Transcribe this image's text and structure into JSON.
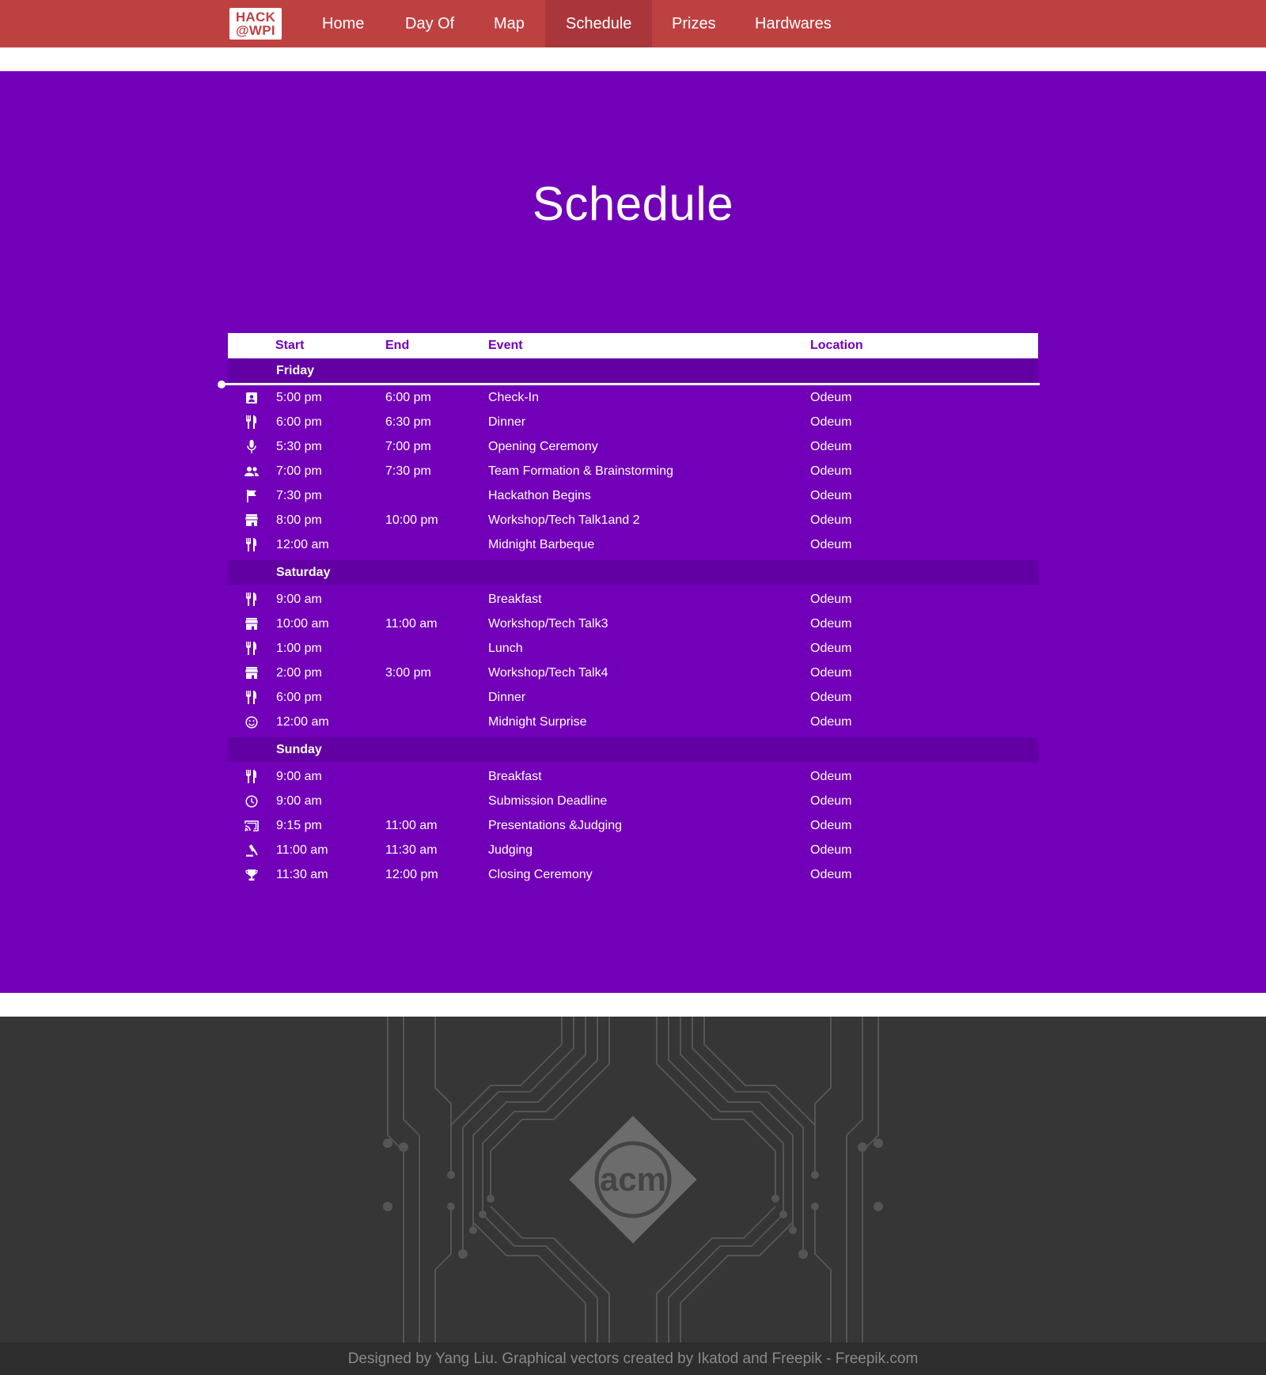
{
  "brand": {
    "logo_line1": "HACK",
    "logo_line2": "@WPI"
  },
  "nav": {
    "items": [
      {
        "label": "Home"
      },
      {
        "label": "Day Of"
      },
      {
        "label": "Map"
      },
      {
        "label": "Schedule"
      },
      {
        "label": "Prizes"
      },
      {
        "label": "Hardwares"
      }
    ],
    "active": "Schedule"
  },
  "page": {
    "title": "Schedule"
  },
  "table": {
    "headers": {
      "start": "Start",
      "end": "End",
      "event": "Event",
      "location": "Location"
    },
    "days": [
      {
        "name": "Friday",
        "events": [
          {
            "icon": "badge-icon",
            "start": "5:00 pm",
            "end": "6:00 pm",
            "event": "Check-In",
            "location": "Odeum"
          },
          {
            "icon": "utensils-icon",
            "start": "6:00 pm",
            "end": "6:30 pm",
            "event": "Dinner",
            "location": "Odeum"
          },
          {
            "icon": "microphone-icon",
            "start": "5:30 pm",
            "end": "7:00 pm",
            "event": "Opening Ceremony",
            "location": "Odeum"
          },
          {
            "icon": "people-icon",
            "start": "7:00 pm",
            "end": "7:30 pm",
            "event": "Team Formation & Brainstorming",
            "location": "Odeum"
          },
          {
            "icon": "flag-icon",
            "start": "7:30 pm",
            "end": "",
            "event": "Hackathon Begins",
            "location": "Odeum"
          },
          {
            "icon": "store-icon",
            "start": "8:00 pm",
            "end": "10:00 pm",
            "event": "Workshop/Tech Talk1and 2",
            "location": "Odeum"
          },
          {
            "icon": "utensils-icon",
            "start": "12:00 am",
            "end": "",
            "event": "Midnight Barbeque",
            "location": "Odeum"
          }
        ]
      },
      {
        "name": "Saturday",
        "events": [
          {
            "icon": "utensils-icon",
            "start": "9:00 am",
            "end": "",
            "event": "Breakfast",
            "location": "Odeum"
          },
          {
            "icon": "store-icon",
            "start": "10:00 am",
            "end": "11:00 am",
            "event": "Workshop/Tech Talk3",
            "location": "Odeum"
          },
          {
            "icon": "utensils-icon",
            "start": "1:00 pm",
            "end": "",
            "event": "Lunch",
            "location": "Odeum"
          },
          {
            "icon": "store-icon",
            "start": "2:00 pm",
            "end": "3:00 pm",
            "event": "Workshop/Tech Talk4",
            "location": "Odeum"
          },
          {
            "icon": "utensils-icon",
            "start": "6:00 pm",
            "end": "",
            "event": "Dinner",
            "location": "Odeum"
          },
          {
            "icon": "smile-icon",
            "start": "12:00 am",
            "end": "",
            "event": "Midnight Surprise",
            "location": "Odeum"
          }
        ]
      },
      {
        "name": "Sunday",
        "events": [
          {
            "icon": "utensils-icon",
            "start": "9:00 am",
            "end": "",
            "event": "Breakfast",
            "location": "Odeum"
          },
          {
            "icon": "clock-icon",
            "start": "9:00 am",
            "end": "",
            "event": "Submission Deadline",
            "location": "Odeum"
          },
          {
            "icon": "cast-icon",
            "start": "9:15 pm",
            "end": "11:00 am",
            "event": "Presentations &Judging",
            "location": "Odeum"
          },
          {
            "icon": "gavel-icon",
            "start": "11:00 am",
            "end": "11:30 am",
            "event": "Judging",
            "location": "Odeum"
          },
          {
            "icon": "trophy-icon",
            "start": "11:30 am",
            "end": "12:00 pm",
            "event": "Closing Ceremony",
            "location": "Odeum"
          }
        ]
      }
    ]
  },
  "footer": {
    "logo_text": "acm",
    "credits": "Designed by Yang Liu. Graphical vectors created by Ikatod and Freepik - Freepik.com"
  },
  "colors": {
    "nav_bg": "#be4142",
    "nav_active": "#a9363a",
    "hero_bg": "#7200b9",
    "day_row_bg": "#6300a3",
    "footer_bg": "#363636"
  }
}
